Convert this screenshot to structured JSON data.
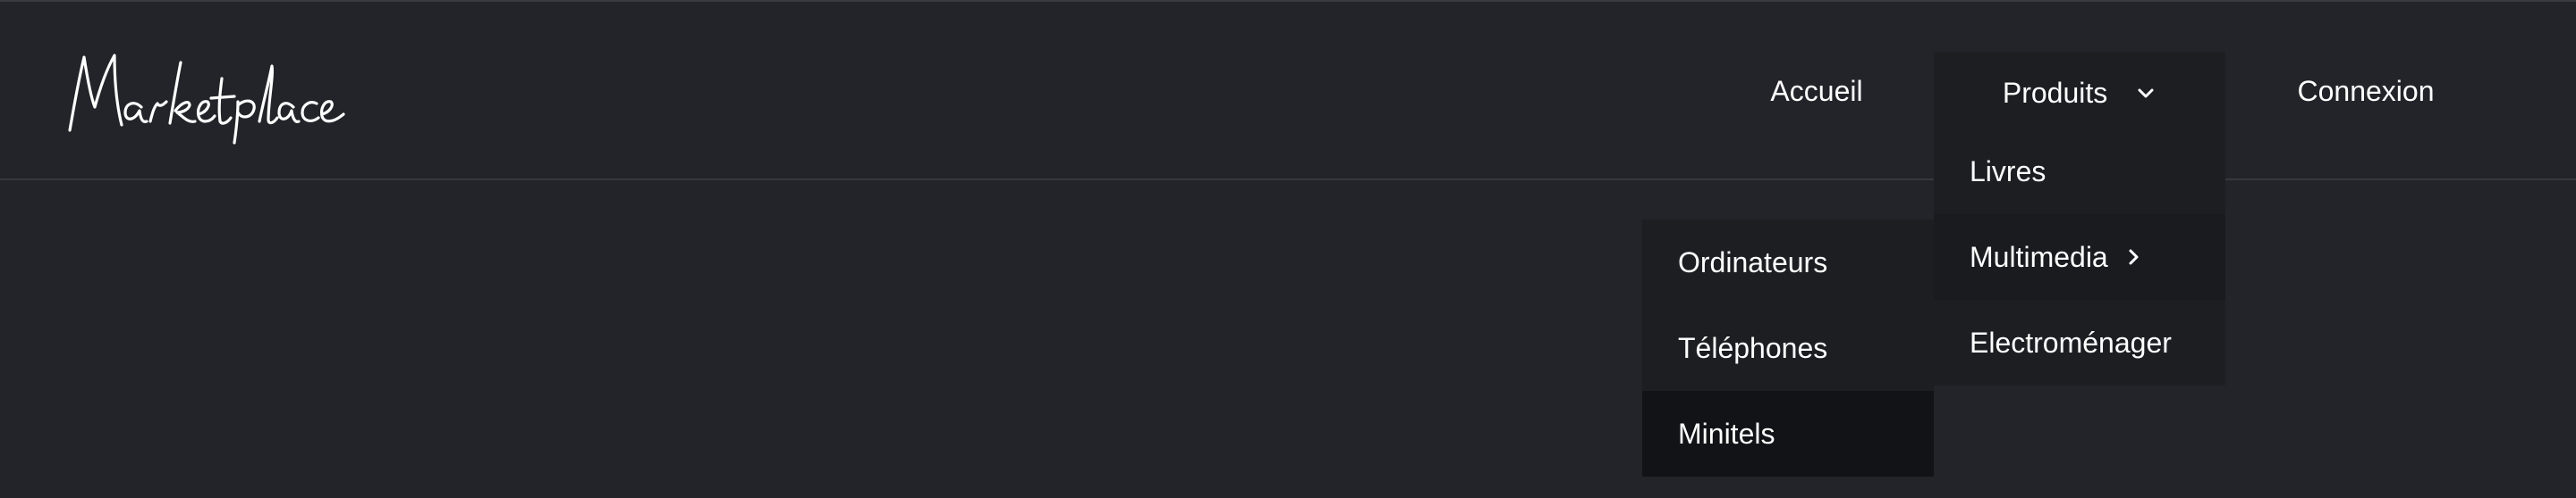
{
  "brand": {
    "logo_text": "Marketplace"
  },
  "nav": {
    "accueil": "Accueil",
    "produits": "Produits",
    "connexion": "Connexion"
  },
  "produits_menu": {
    "items": [
      {
        "label": "Livres"
      },
      {
        "label": "Multimedia"
      },
      {
        "label": "Electroménager"
      }
    ]
  },
  "multimedia_menu": {
    "items": [
      {
        "label": "Ordinateurs"
      },
      {
        "label": "Téléphones"
      },
      {
        "label": "Minitels"
      }
    ]
  },
  "icons": {
    "produits_chevron": "chevron-down-icon",
    "multimedia_chevron": "chevron-right-icon"
  },
  "colors": {
    "background": "#232429",
    "menu_background": "#1d1e22",
    "active_item": "#1a1b1f",
    "hover_item": "#121316",
    "text": "#ffffff"
  }
}
